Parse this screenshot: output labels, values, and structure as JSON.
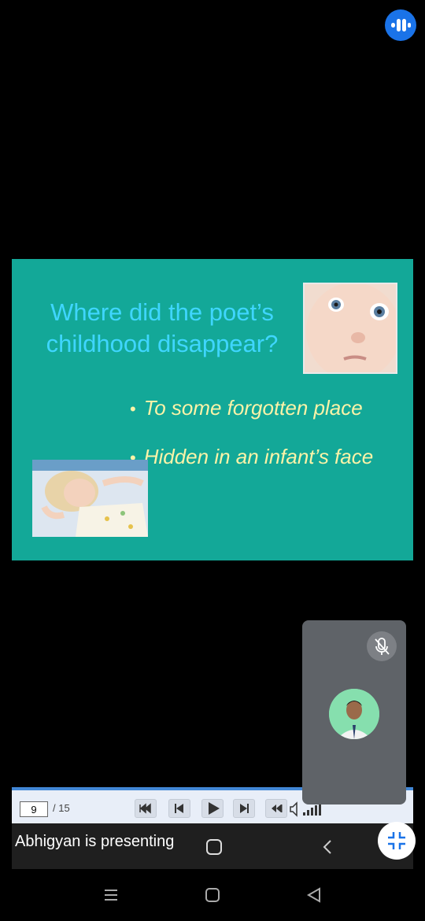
{
  "slide": {
    "title": "Where did the poet’s childhood disappear?",
    "bullets": [
      "To some forgotten place",
      "Hidden in an infant’s face"
    ],
    "images": [
      "baby-face-photo",
      "sleeping-baby-photo"
    ]
  },
  "toolbar": {
    "current_page": "9",
    "total_pages": "/ 15"
  },
  "banner": {
    "presenter_text": "Abhigyan is presenting"
  },
  "participant": {
    "mic_status": "muted"
  },
  "colors": {
    "slide_bg": "#13a898",
    "title": "#3fd6ff",
    "bullets": "#fbf3a8",
    "accent": "#1a73e8"
  },
  "icons": [
    "meet-logo-icon",
    "mic-off-icon",
    "exit-fullscreen-icon",
    "back-icon",
    "recents-icon",
    "home-icon",
    "nav-back-icon"
  ]
}
